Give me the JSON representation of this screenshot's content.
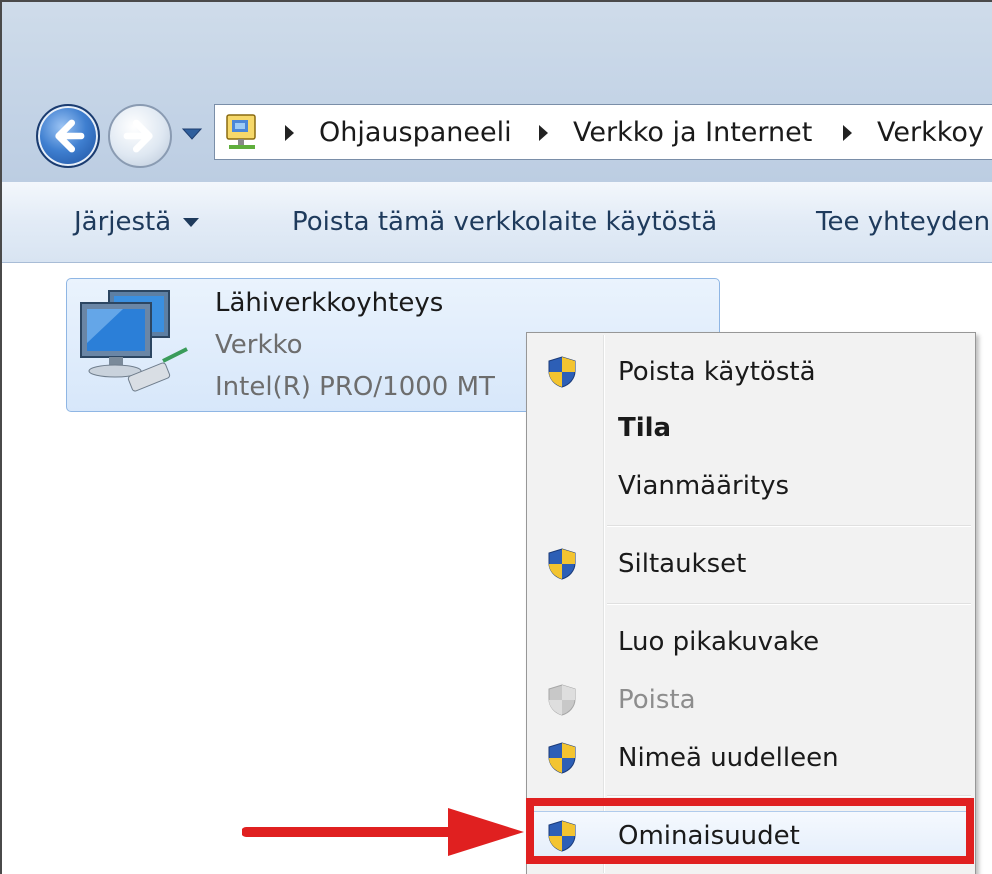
{
  "navigation": {
    "back_icon": "back-arrow-icon",
    "forward_icon": "forward-arrow-icon"
  },
  "address_bar": {
    "location_icon": "control-panel-icon",
    "breadcrumbs": [
      "Ohjauspaneeli",
      "Verkko ja Internet",
      "Verkkoy"
    ]
  },
  "toolbar": {
    "organize_label": "Järjestä",
    "disable_label": "Poista tämä verkkolaite käytöstä",
    "connect_label": "Tee yhteyden"
  },
  "network_item": {
    "name": "Lähiverkkoyhteys",
    "network": "Verkko",
    "device": "Intel(R) PRO/1000 MT"
  },
  "context_menu": {
    "items": [
      {
        "label": "Poista käytöstä",
        "icon": "uac-shield-icon"
      },
      {
        "label": "Tila",
        "bold": true
      },
      {
        "label": "Vianmääritys"
      },
      {
        "label": "Siltaukset",
        "icon": "uac-shield-icon"
      },
      {
        "label": "Luo pikakuvake"
      },
      {
        "label": "Poista",
        "icon": "uac-shield-icon",
        "disabled": true
      },
      {
        "label": "Nimeä uudelleen",
        "icon": "uac-shield-icon"
      },
      {
        "label": "Ominaisuudet",
        "icon": "uac-shield-icon",
        "highlighted": true
      }
    ]
  },
  "annotation": {
    "color": "#e02020",
    "target": "Ominaisuudet"
  }
}
